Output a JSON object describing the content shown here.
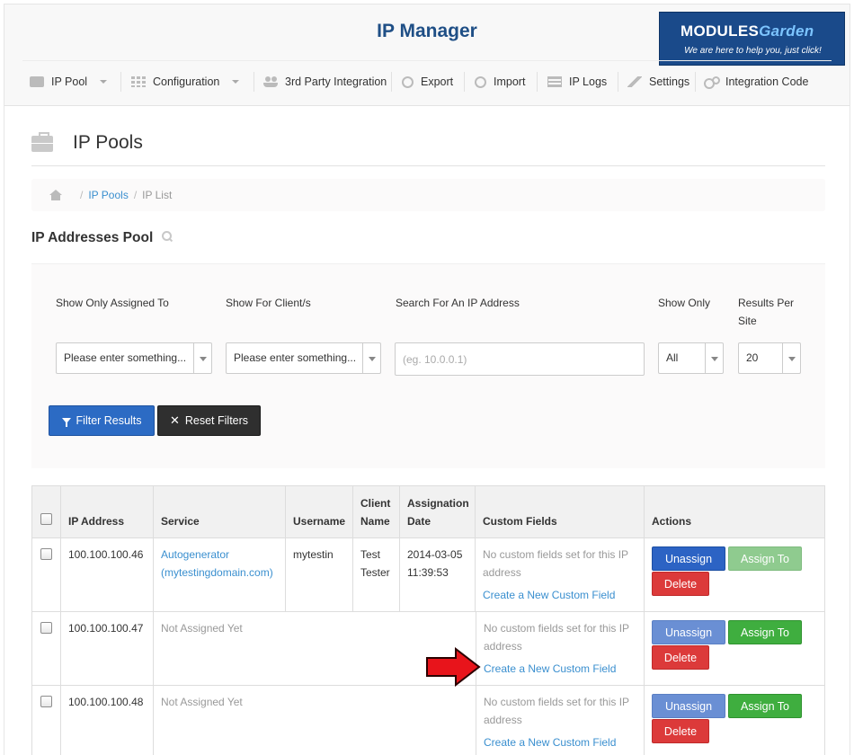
{
  "app": {
    "title": "IP Manager"
  },
  "brand": {
    "logo_part1": "MODULES",
    "logo_part2": "Garden",
    "tagline": "We are here to help you, just click!"
  },
  "nav": {
    "items": [
      {
        "label": "IP Pool",
        "icon": "briefcase-icon"
      },
      {
        "label": "Configuration",
        "icon": "grid-icon"
      },
      {
        "label": "3rd Party Integration",
        "icon": "users-icon"
      },
      {
        "label": "Export",
        "icon": "export-icon"
      },
      {
        "label": "Import",
        "icon": "import-icon"
      },
      {
        "label": "IP Logs",
        "icon": "list-icon"
      },
      {
        "label": "Settings",
        "icon": "wrench-icon"
      },
      {
        "label": "Integration Code",
        "icon": "gears-icon"
      }
    ]
  },
  "page": {
    "title": "IP Pools"
  },
  "breadcrumb": {
    "items": [
      "IP Pools",
      "IP List"
    ],
    "sep": "/"
  },
  "section": {
    "title": "IP Addresses Pool"
  },
  "filters": {
    "assigned_to": {
      "label": "Show Only Assigned To",
      "value": "Please enter something..."
    },
    "clients": {
      "label": "Show For Client/s",
      "value": "Please enter something..."
    },
    "search": {
      "label": "Search For An IP Address",
      "placeholder": "(eg. 10.0.0.1)"
    },
    "show_only": {
      "label": "Show Only",
      "value": "All"
    },
    "per_site": {
      "label_line1": "Results Per",
      "label_line2": "Site",
      "value": "20"
    },
    "filter_button": "Filter Results",
    "reset_button": "Reset Filters"
  },
  "table": {
    "headers": {
      "ip": "IP Address",
      "service": "Service",
      "username": "Username",
      "client_l1": "Client",
      "client_l2": "Name",
      "date_l1": "Assignation",
      "date_l2": "Date",
      "custom": "Custom Fields",
      "actions": "Actions"
    },
    "rows": [
      {
        "ip": "100.100.100.46",
        "service_l1": "Autogenerator",
        "service_l2": "(mytestingdomain.com)",
        "username": "mytestin",
        "client_l1": "Test",
        "client_l2": "Tester",
        "date_l1": "2014-03-05",
        "date_l2": "11:39:53",
        "custom_l1": "No custom fields set for this IP",
        "custom_l2": "address",
        "custom_link": "Create a New Custom Field",
        "unassign": "Unassign",
        "assign": "Assign To",
        "delete": "Delete"
      },
      {
        "ip": "100.100.100.47",
        "service_l1": "Not Assigned Yet",
        "custom_l1": "No custom fields set for this IP",
        "custom_l2": "address",
        "custom_link": "Create a New Custom Field",
        "unassign": "Unassign",
        "assign": "Assign To",
        "delete": "Delete"
      },
      {
        "ip": "100.100.100.48",
        "service_l1": "Not Assigned Yet",
        "custom_l1": "No custom fields set for this IP",
        "custom_l2": "address",
        "custom_link": "Create a New Custom Field",
        "unassign": "Unassign",
        "assign": "Assign To",
        "delete": "Delete"
      }
    ]
  },
  "colors": {
    "accent_blue": "#2c63c4",
    "title_blue": "#1f4f86",
    "green": "#3fae3f",
    "red": "#dc3a3a",
    "link": "#3a8fcf",
    "arrow": "#e8141b"
  }
}
